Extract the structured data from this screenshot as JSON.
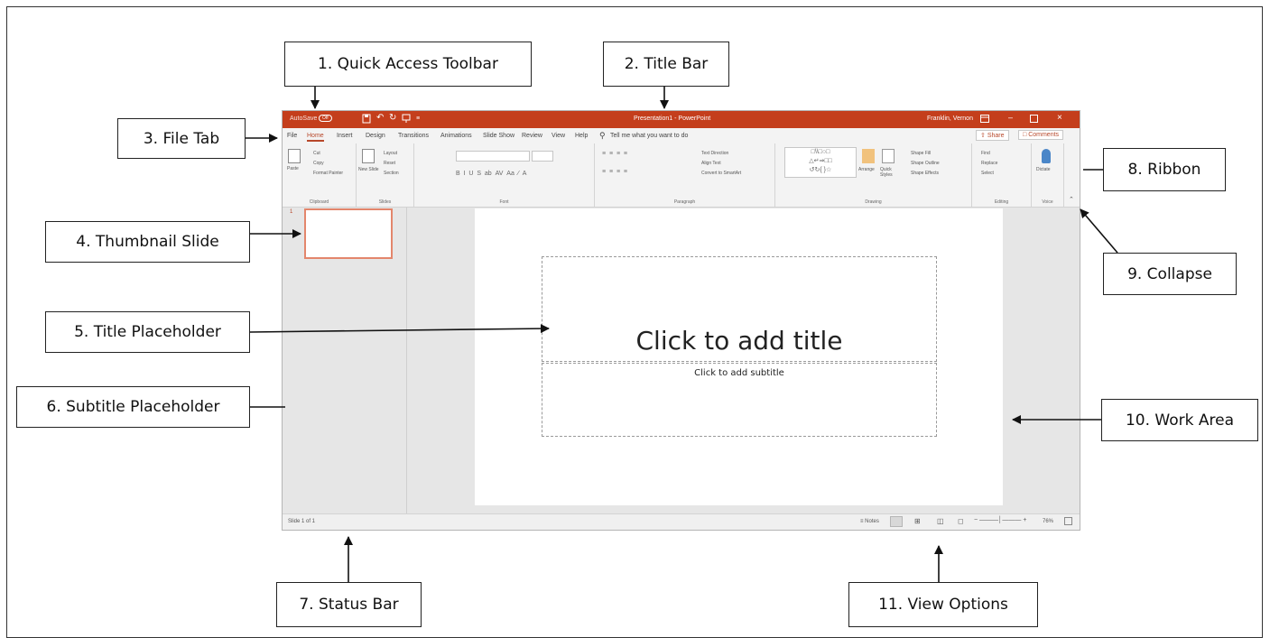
{
  "callouts": {
    "quick_access_toolbar": "1. Quick Access Toolbar",
    "title_bar": "2. Title Bar",
    "file_tab": "3. File Tab",
    "thumbnail_slide": "4. Thumbnail Slide",
    "title_placeholder": "5. Title Placeholder",
    "subtitle_placeholder": "6. Subtitle Placeholder",
    "status_bar": "7. Status Bar",
    "ribbon": "8. Ribbon",
    "collapse": "9. Collapse",
    "work_area": "10. Work Area",
    "view_options": "11. View Options"
  },
  "window": {
    "autosave": "AutoSave",
    "autosave_state": "Off",
    "document_title": "Presentation1 - PowerPoint",
    "user_name": "Franklin, Vernon",
    "accent_color": "#c43e1c"
  },
  "tabs": [
    "File",
    "Home",
    "Insert",
    "Design",
    "Transitions",
    "Animations",
    "Slide Show",
    "Review",
    "View",
    "Help"
  ],
  "tell_me": "Tell me what you want to do",
  "share_label": "Share",
  "comments_label": "Comments",
  "ribbon": {
    "clipboard": {
      "label": "Clipboard",
      "paste": "Paste",
      "cut": "Cut",
      "copy": "Copy",
      "format_painter": "Format Painter"
    },
    "slides": {
      "label": "Slides",
      "new_slide": "New Slide",
      "layout": "Layout",
      "reset": "Reset",
      "section": "Section"
    },
    "font": {
      "label": "Font"
    },
    "paragraph": {
      "label": "Paragraph",
      "text_direction": "Text Direction",
      "align_text": "Align Text",
      "convert_smartart": "Convert to SmartArt"
    },
    "drawing": {
      "label": "Drawing",
      "arrange": "Arrange",
      "quick_styles": "Quick Styles",
      "shape_fill": "Shape Fill",
      "shape_outline": "Shape Outline",
      "shape_effects": "Shape Effects"
    },
    "editing": {
      "label": "Editing",
      "find": "Find",
      "replace": "Replace",
      "select": "Select"
    },
    "voice": {
      "label": "Voice",
      "dictate": "Dictate"
    }
  },
  "thumbnail_number": "1",
  "slide": {
    "title_placeholder": "Click to add title",
    "subtitle_placeholder": "Click to add subtitle"
  },
  "status": {
    "slide_count": "Slide 1 of 1",
    "notes": "Notes",
    "zoom": "76%"
  }
}
